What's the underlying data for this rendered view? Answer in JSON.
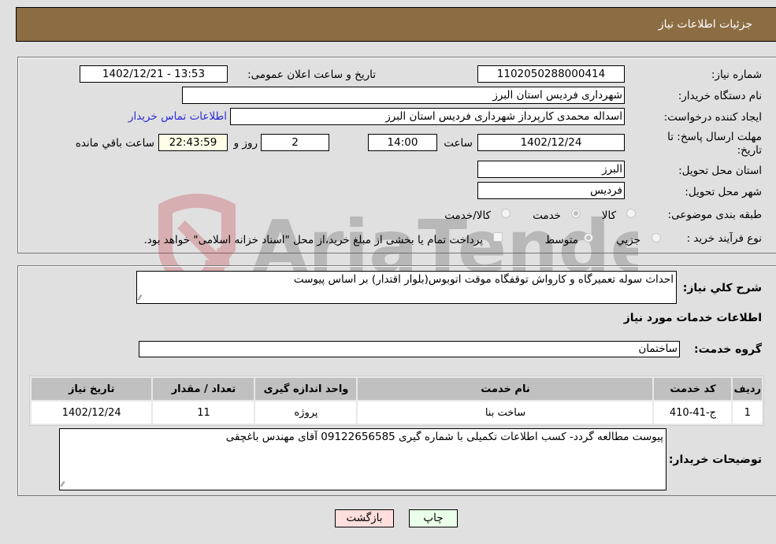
{
  "header": {
    "title": "جزئیات اطلاعات نیاز"
  },
  "form": {
    "need_number": {
      "label": "شماره نیاز:",
      "value": "1102050288000414"
    },
    "announce_datetime": {
      "label": "تاریخ و ساعت اعلان عمومی:",
      "value": "1402/12/21 - 13:53"
    },
    "buyer_org": {
      "label": "نام دستگاه خریدار:",
      "value": "شهرداری فردیس استان البرز"
    },
    "requester": {
      "label": "ایجاد کننده درخواست:",
      "value": "اسداله محمدی کارپرداز شهرداری فردیس استان البرز"
    },
    "contact_link": "اطلاعات تماس خریدار",
    "deadline": {
      "label": "مهلت ارسال پاسخ: تا تاریخ:",
      "date": "1402/12/24",
      "time_label": "ساعت",
      "time": "14:00",
      "days": "2",
      "days_label": "روز و",
      "remaining": "22:43:59",
      "remaining_label": "ساعت باقي مانده"
    },
    "delivery_province": {
      "label": "استان محل تحویل:",
      "value": "البرز"
    },
    "delivery_city": {
      "label": "شهر محل تحویل:",
      "value": "فردیس"
    },
    "category": {
      "label": "طبقه بندی موضوعی:",
      "options": [
        "کالا",
        "خدمت",
        "کالا/خدمت"
      ],
      "selected": "خدمت"
    },
    "purchase_type": {
      "label": "نوع فرآیند خرید :",
      "options": [
        "جزيي",
        "متوسط"
      ],
      "selected": "متوسط",
      "treasury_note": "پرداخت تمام یا بخشی از مبلغ خرید،از محل \"اسناد خزانه اسلامی\" خواهد بود."
    }
  },
  "details": {
    "description_label": "شرح کلي نیاز:",
    "description": "احداث سوله تعمیرگاه و کارواش توقفگاه موقت اتوبوس(بلوار اقتدار) بر اساس پیوست",
    "services_heading": "اطلاعات خدمات مورد نیاز",
    "service_group_label": "گروه خدمت:",
    "service_group": "ساختمان",
    "table": {
      "headers": [
        "ردیف",
        "کد خدمت",
        "نام خدمت",
        "واحد اندازه گیری",
        "تعداد / مقدار",
        "تاریخ نیاز"
      ],
      "rows": [
        [
          "1",
          "ج-41-410",
          "ساخت بنا",
          "پروژه",
          "11",
          "1402/12/24"
        ]
      ]
    },
    "buyer_notes_label": "توضیحات خریدار:",
    "buyer_notes": "پیوست مطالعه گردد- کسب اطلاعات تکمیلی با شماره گیری 09122656585 آقای مهندس باغچقی"
  },
  "buttons": {
    "print": "چاپ",
    "back": "بازگشت"
  },
  "watermark": "AriaTender.neT"
}
